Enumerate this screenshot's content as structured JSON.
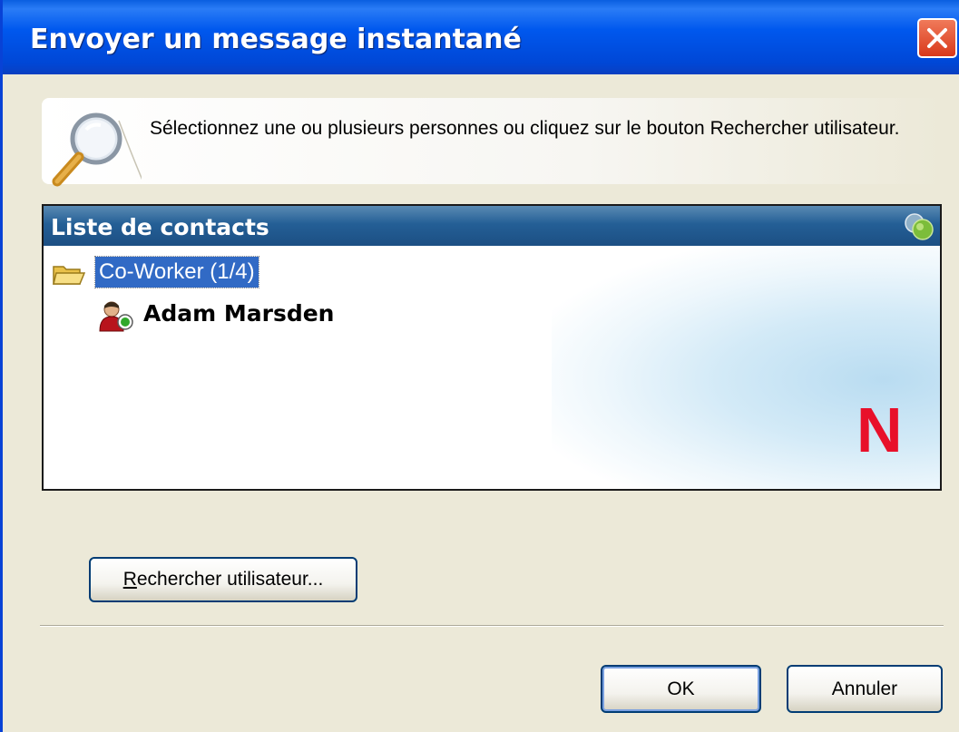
{
  "window": {
    "title": "Envoyer un message instantané",
    "close_icon": "close-icon"
  },
  "info": {
    "text": "Sélectionnez une ou plusieurs personnes ou cliquez sur le bouton Rechercher utilisateur.",
    "icon": "magnifier-icon"
  },
  "contacts": {
    "header": "Liste de contacts",
    "groups": [
      {
        "label": "Co-Worker  (1/4)",
        "selected": true,
        "members": [
          {
            "name": "Adam Marsden",
            "status": "online"
          }
        ]
      }
    ],
    "watermark_logo": "N"
  },
  "buttons": {
    "search_user": "Rechercher utilisateur...",
    "ok": "OK",
    "cancel": "Annuler"
  },
  "colors": {
    "titlebar": "#0058ee",
    "contacts_header": "#245f96",
    "selection": "#316ac5",
    "logo_red": "#e8102a"
  }
}
